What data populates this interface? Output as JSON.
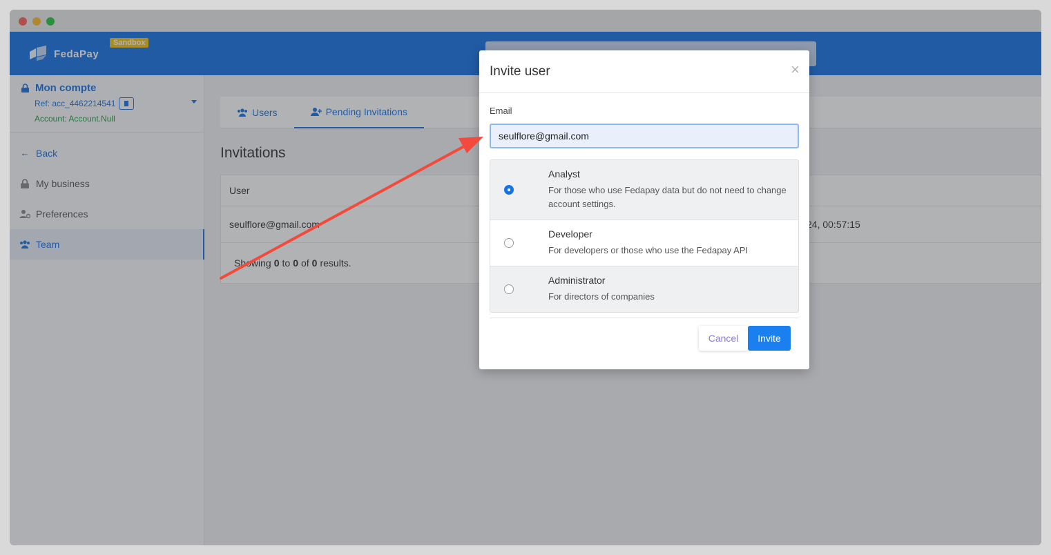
{
  "app": {
    "logo_text": "FedaPay",
    "env_badge": "Sandbox"
  },
  "sidebar": {
    "account_title": "Mon compte",
    "ref": "Ref: acc_4462214541",
    "account_name": "Account: Account.Null",
    "items": [
      {
        "label": "Back"
      },
      {
        "label": "My business"
      },
      {
        "label": "Preferences"
      },
      {
        "label": "Team"
      }
    ]
  },
  "main": {
    "tabs": [
      {
        "label": "Users"
      },
      {
        "label": "Pending Invitations"
      }
    ],
    "section_title": "Invitations",
    "table": {
      "header_user": "User",
      "rows": [
        {
          "user": "seulflore@gmail.com",
          "date_partial": "24, 00:57:15"
        }
      ],
      "footer_prefix": "Showing",
      "footer_from": "0",
      "footer_to_word": "to",
      "footer_to": "0",
      "footer_of_word": "of",
      "footer_total": "0",
      "footer_suffix": "results."
    }
  },
  "modal": {
    "title": "Invite user",
    "close_glyph": "×",
    "email_label": "Email",
    "email_value": "seulflore@gmail.com",
    "roles": [
      {
        "name": "Analyst",
        "description": "For those who use Fedapay data but do not need to change account settings.",
        "selected": true
      },
      {
        "name": "Developer",
        "description": "For developers or those who use the Fedapay API",
        "selected": false
      },
      {
        "name": "Administrator",
        "description": "For directors of companies",
        "selected": false
      }
    ],
    "cancel_label": "Cancel",
    "invite_label": "Invite"
  },
  "colors": {
    "brand_blue": "#1673e6",
    "badge_yellow": "#f2c318",
    "arrow_red": "#f24a3d"
  }
}
